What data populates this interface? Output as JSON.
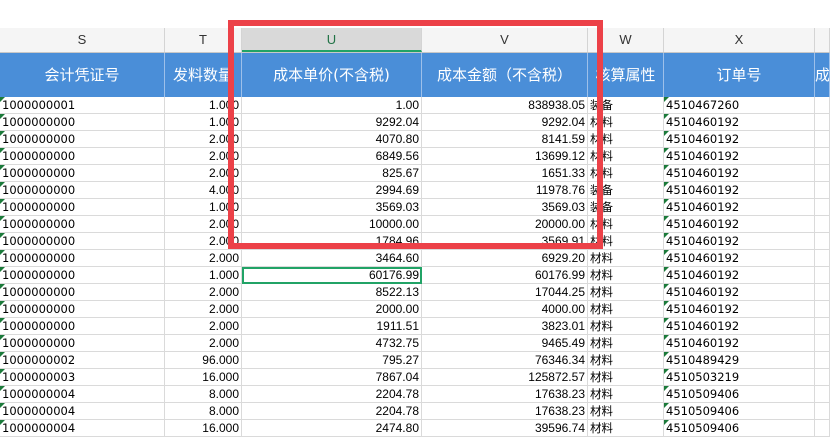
{
  "column_letters": [
    "S",
    "T",
    "U",
    "V",
    "W",
    "X",
    ""
  ],
  "headers": [
    "会计凭证号",
    "发料数量",
    "成本单价(不含税)",
    "成本金额（不含税）",
    "核算属性",
    "订单号",
    "成"
  ],
  "rows": [
    {
      "voucher": "1000000001",
      "qty": "1.000",
      "price": "1.00",
      "amount": "838938.05",
      "attr": "装备",
      "order": "4510467260"
    },
    {
      "voucher": "1000000000",
      "qty": "1.000",
      "price": "9292.04",
      "amount": "9292.04",
      "attr": "材料",
      "order": "4510460192"
    },
    {
      "voucher": "1000000000",
      "qty": "2.000",
      "price": "4070.80",
      "amount": "8141.59",
      "attr": "材料",
      "order": "4510460192"
    },
    {
      "voucher": "1000000000",
      "qty": "2.000",
      "price": "6849.56",
      "amount": "13699.12",
      "attr": "材料",
      "order": "4510460192"
    },
    {
      "voucher": "1000000000",
      "qty": "2.000",
      "price": "825.67",
      "amount": "1651.33",
      "attr": "材料",
      "order": "4510460192"
    },
    {
      "voucher": "1000000000",
      "qty": "4.000",
      "price": "2994.69",
      "amount": "11978.76",
      "attr": "装备",
      "order": "4510460192"
    },
    {
      "voucher": "1000000000",
      "qty": "1.000",
      "price": "3569.03",
      "amount": "3569.03",
      "attr": "装备",
      "order": "4510460192"
    },
    {
      "voucher": "1000000000",
      "qty": "2.000",
      "price": "10000.00",
      "amount": "20000.00",
      "attr": "材料",
      "order": "4510460192"
    },
    {
      "voucher": "1000000000",
      "qty": "2.000",
      "price": "1784.96",
      "amount": "3569.91",
      "attr": "材料",
      "order": "4510460192"
    },
    {
      "voucher": "1000000000",
      "qty": "2.000",
      "price": "3464.60",
      "amount": "6929.20",
      "attr": "材料",
      "order": "4510460192"
    },
    {
      "voucher": "1000000000",
      "qty": "1.000",
      "price": "60176.99",
      "amount": "60176.99",
      "attr": "材料",
      "order": "4510460192"
    },
    {
      "voucher": "1000000000",
      "qty": "2.000",
      "price": "8522.13",
      "amount": "17044.25",
      "attr": "材料",
      "order": "4510460192"
    },
    {
      "voucher": "1000000000",
      "qty": "2.000",
      "price": "2000.00",
      "amount": "4000.00",
      "attr": "材料",
      "order": "4510460192"
    },
    {
      "voucher": "1000000000",
      "qty": "2.000",
      "price": "1911.51",
      "amount": "3823.01",
      "attr": "材料",
      "order": "4510460192"
    },
    {
      "voucher": "1000000000",
      "qty": "2.000",
      "price": "4732.75",
      "amount": "9465.49",
      "attr": "材料",
      "order": "4510460192"
    },
    {
      "voucher": "1000000002",
      "qty": "96.000",
      "price": "795.27",
      "amount": "76346.34",
      "attr": "材料",
      "order": "4510489429"
    },
    {
      "voucher": "1000000003",
      "qty": "16.000",
      "price": "7867.04",
      "amount": "125872.57",
      "attr": "材料",
      "order": "4510503219"
    },
    {
      "voucher": "1000000004",
      "qty": "8.000",
      "price": "2204.78",
      "amount": "17638.23",
      "attr": "材料",
      "order": "4510509406"
    },
    {
      "voucher": "1000000004",
      "qty": "8.000",
      "price": "2204.78",
      "amount": "17638.23",
      "attr": "材料",
      "order": "4510509406"
    },
    {
      "voucher": "1000000004",
      "qty": "16.000",
      "price": "2474.80",
      "amount": "39596.74",
      "attr": "材料",
      "order": "4510509406"
    }
  ],
  "colors": {
    "header_bg": "#4a8ed8",
    "highlight_box": "#ec4148",
    "selection": "#21a366"
  }
}
